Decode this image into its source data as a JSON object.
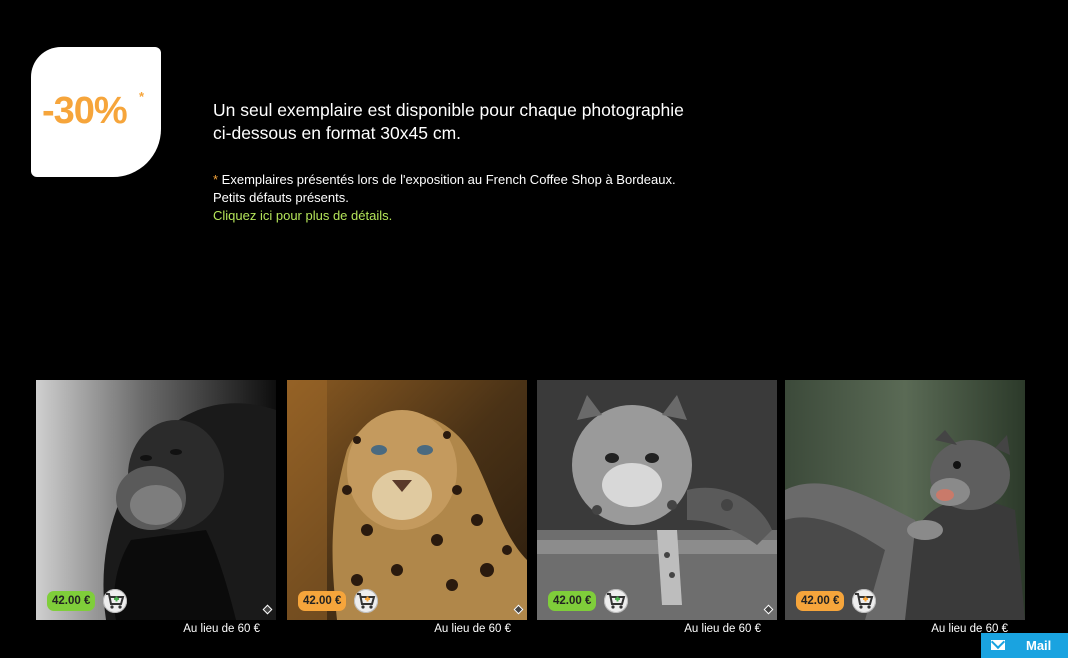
{
  "promo": {
    "discount": "-30%",
    "asterisk": "*"
  },
  "intro": {
    "line1": "Un seul exemplaire est disponible pour chaque photographie",
    "line2": "ci-dessous en format 30x45 cm."
  },
  "notes": {
    "asterisk": "*",
    "line1": " Exemplaires présentés lors de l'exposition au French Coffee Shop à Bordeaux.",
    "line2": "Petits défauts présents.",
    "link": "Cliquez ici pour plus de détails."
  },
  "products": [
    {
      "subject": "orangutan",
      "price": "42.00 €",
      "was": "Au lieu de 60 €",
      "price_color": "#7fce3a"
    },
    {
      "subject": "leopard",
      "price": "42.00 €",
      "was": "Au lieu de 60 €",
      "price_color": "#f6a53b"
    },
    {
      "subject": "clouded leopard",
      "price": "42.00 €",
      "was": "Au lieu de 60 €",
      "price_color": "#7fce3a"
    },
    {
      "subject": "binturong",
      "price": "42.00 €",
      "was": "Au lieu de 60 €",
      "price_color": "#f6a53b"
    }
  ],
  "mail": {
    "label": "Mail"
  },
  "colors": {
    "accent_orange": "#f6a53b",
    "accent_green": "#7fce3a",
    "link_green": "#b5e55a",
    "mail_blue": "#1aa3e0"
  }
}
